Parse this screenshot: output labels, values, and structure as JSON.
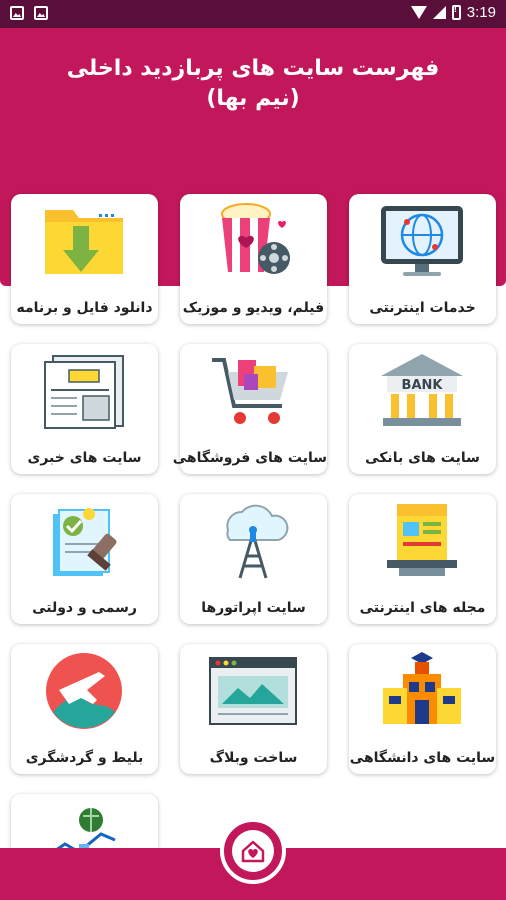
{
  "status_bar": {
    "time": "3:19"
  },
  "header": {
    "title_line1": "فهرست سایت های پربازدید داخلی",
    "title_line2": "(نیم بها)"
  },
  "cards": [
    {
      "label": "خدمات اینترنتی",
      "icon": "globe-monitor-icon"
    },
    {
      "label": "فیلم، ویدیو و موزیک",
      "icon": "popcorn-film-icon"
    },
    {
      "label": "دانلود فایل و برنامه",
      "icon": "download-folder-icon"
    },
    {
      "label": "سایت های بانکی",
      "icon": "bank-icon"
    },
    {
      "label": "سایت های فروشگاهی",
      "icon": "shopping-cart-icon"
    },
    {
      "label": "سایت های خبری",
      "icon": "newspaper-icon"
    },
    {
      "label": "مجله های اینترنتی",
      "icon": "magazine-stand-icon"
    },
    {
      "label": "سایت اپراتورها",
      "icon": "cell-tower-icon"
    },
    {
      "label": "رسمی و دولتی",
      "icon": "official-stamp-icon"
    },
    {
      "label": "سایت های دانشگاهی",
      "icon": "university-icon"
    },
    {
      "label": "ساخت وبلاگ",
      "icon": "web-page-icon"
    },
    {
      "label": "بلیط و گردشگری",
      "icon": "airplane-globe-icon"
    },
    {
      "label": "",
      "icon": "growth-chart-icon"
    }
  ],
  "colors": {
    "primary": "#c2185b",
    "status_bar": "#5a0f3a"
  }
}
